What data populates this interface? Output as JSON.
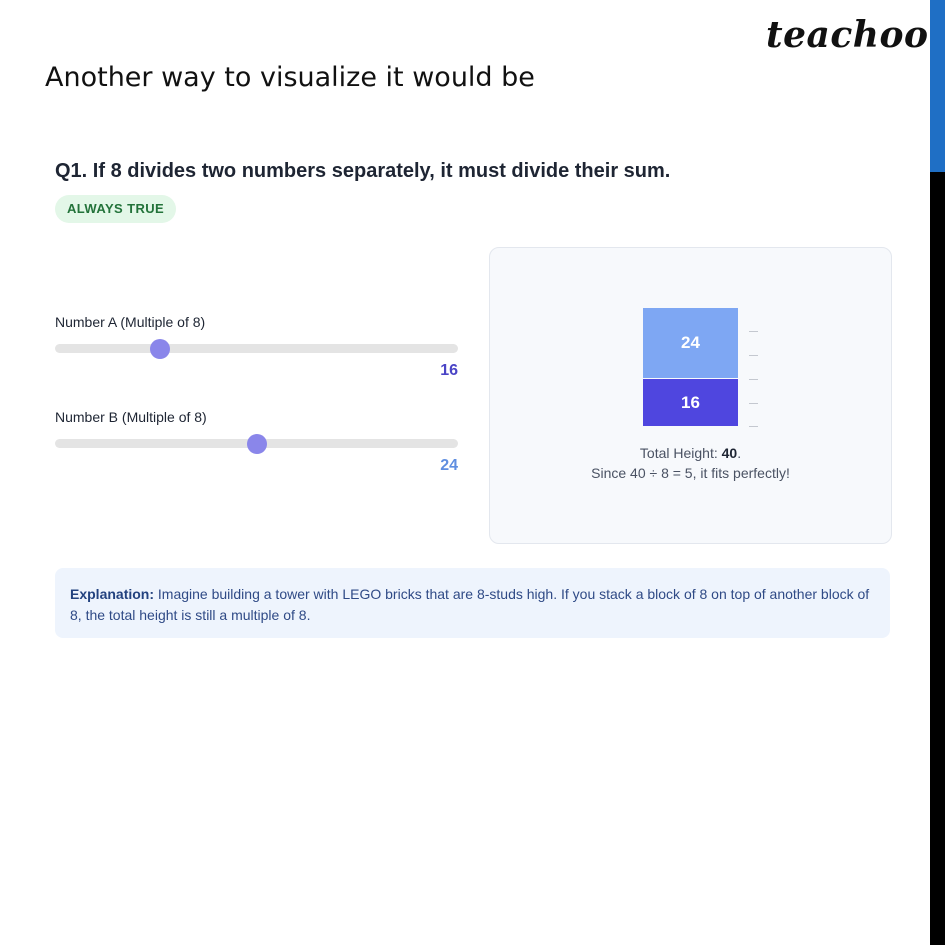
{
  "brand": "teachoo",
  "intro": "Another way to visualize it would be",
  "question": "Q1. If 8 divides two numbers separately, it must divide their sum.",
  "badge": "ALWAYS TRUE",
  "sliders": [
    {
      "label": "Number A (Multiple of 8)",
      "value": "16",
      "fraction": 0.26,
      "value_color": "#4a44c6"
    },
    {
      "label": "Number B (Multiple of 8)",
      "value": "24",
      "fraction": 0.5,
      "value_color": "#5f8ee0"
    }
  ],
  "tower": {
    "top_block": {
      "label": "24",
      "color": "#7ea7f3"
    },
    "bottom_block": {
      "label": "16",
      "color": "#4f46df"
    },
    "total_label": "Total Height:",
    "total_value": "40",
    "total_suffix": ".",
    "since_text": "Since 40 ÷ 8 = 5, it fits perfectly!"
  },
  "explanation": {
    "label": "Explanation:",
    "text": "Imagine building a tower with LEGO bricks that are 8-studs high. If you stack a block of 8 on top of another block of 8, the total height is still a multiple of 8."
  },
  "colors": {
    "accent_blue": "#1f6fc5",
    "thumb": "#8a86ea",
    "badge_bg": "#e3f7e8",
    "badge_text": "#23733a"
  }
}
